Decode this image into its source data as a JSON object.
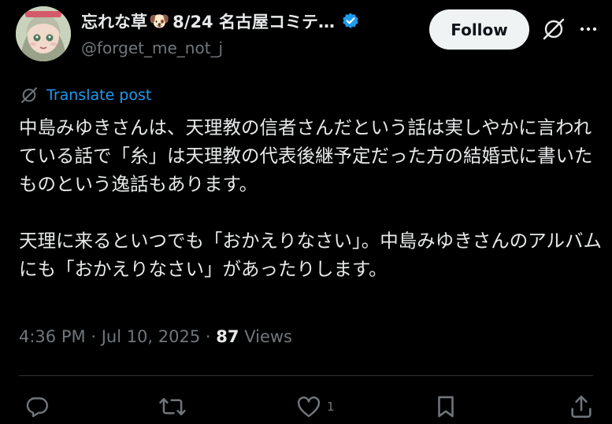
{
  "author": {
    "display_name": "忘れな草",
    "dog_emoji": "🐶",
    "name_suffix": "8/24 名古屋コミテ…",
    "handle": "@forget_me_not_j",
    "avatar": "anime-character-avatar",
    "verified": true
  },
  "header": {
    "follow_label": "Follow",
    "grok_icon": "grok-icon",
    "more_icon": "more-icon"
  },
  "post": {
    "translate_label": "Translate post",
    "paragraphs": [
      "中島みゆきさんは、天理教の信者さんだという話は実しやかに言われている話で「糸」は天理教の代表後継予定だった方の結婚式に書いたものという逸話もあります。",
      "天理に来るといつでも「おかえりなさい」。中島みゆきさんのアルバムにも「おかえりなさい」があったりします。"
    ],
    "time": "4:36 PM",
    "separator": "·",
    "date": "Jul 10, 2025",
    "views_count": "87",
    "views_label": "Views"
  },
  "actions": {
    "reply_icon": "reply-icon",
    "repost_icon": "repost-icon",
    "like_icon": "heart-icon",
    "like_count": "1",
    "bookmark_icon": "bookmark-icon",
    "share_icon": "share-icon"
  },
  "colors": {
    "background": "#000000",
    "text": "#e7e9ea",
    "muted": "#71767b",
    "accent": "#1d9bf0",
    "follow_bg": "#eff3f4"
  }
}
